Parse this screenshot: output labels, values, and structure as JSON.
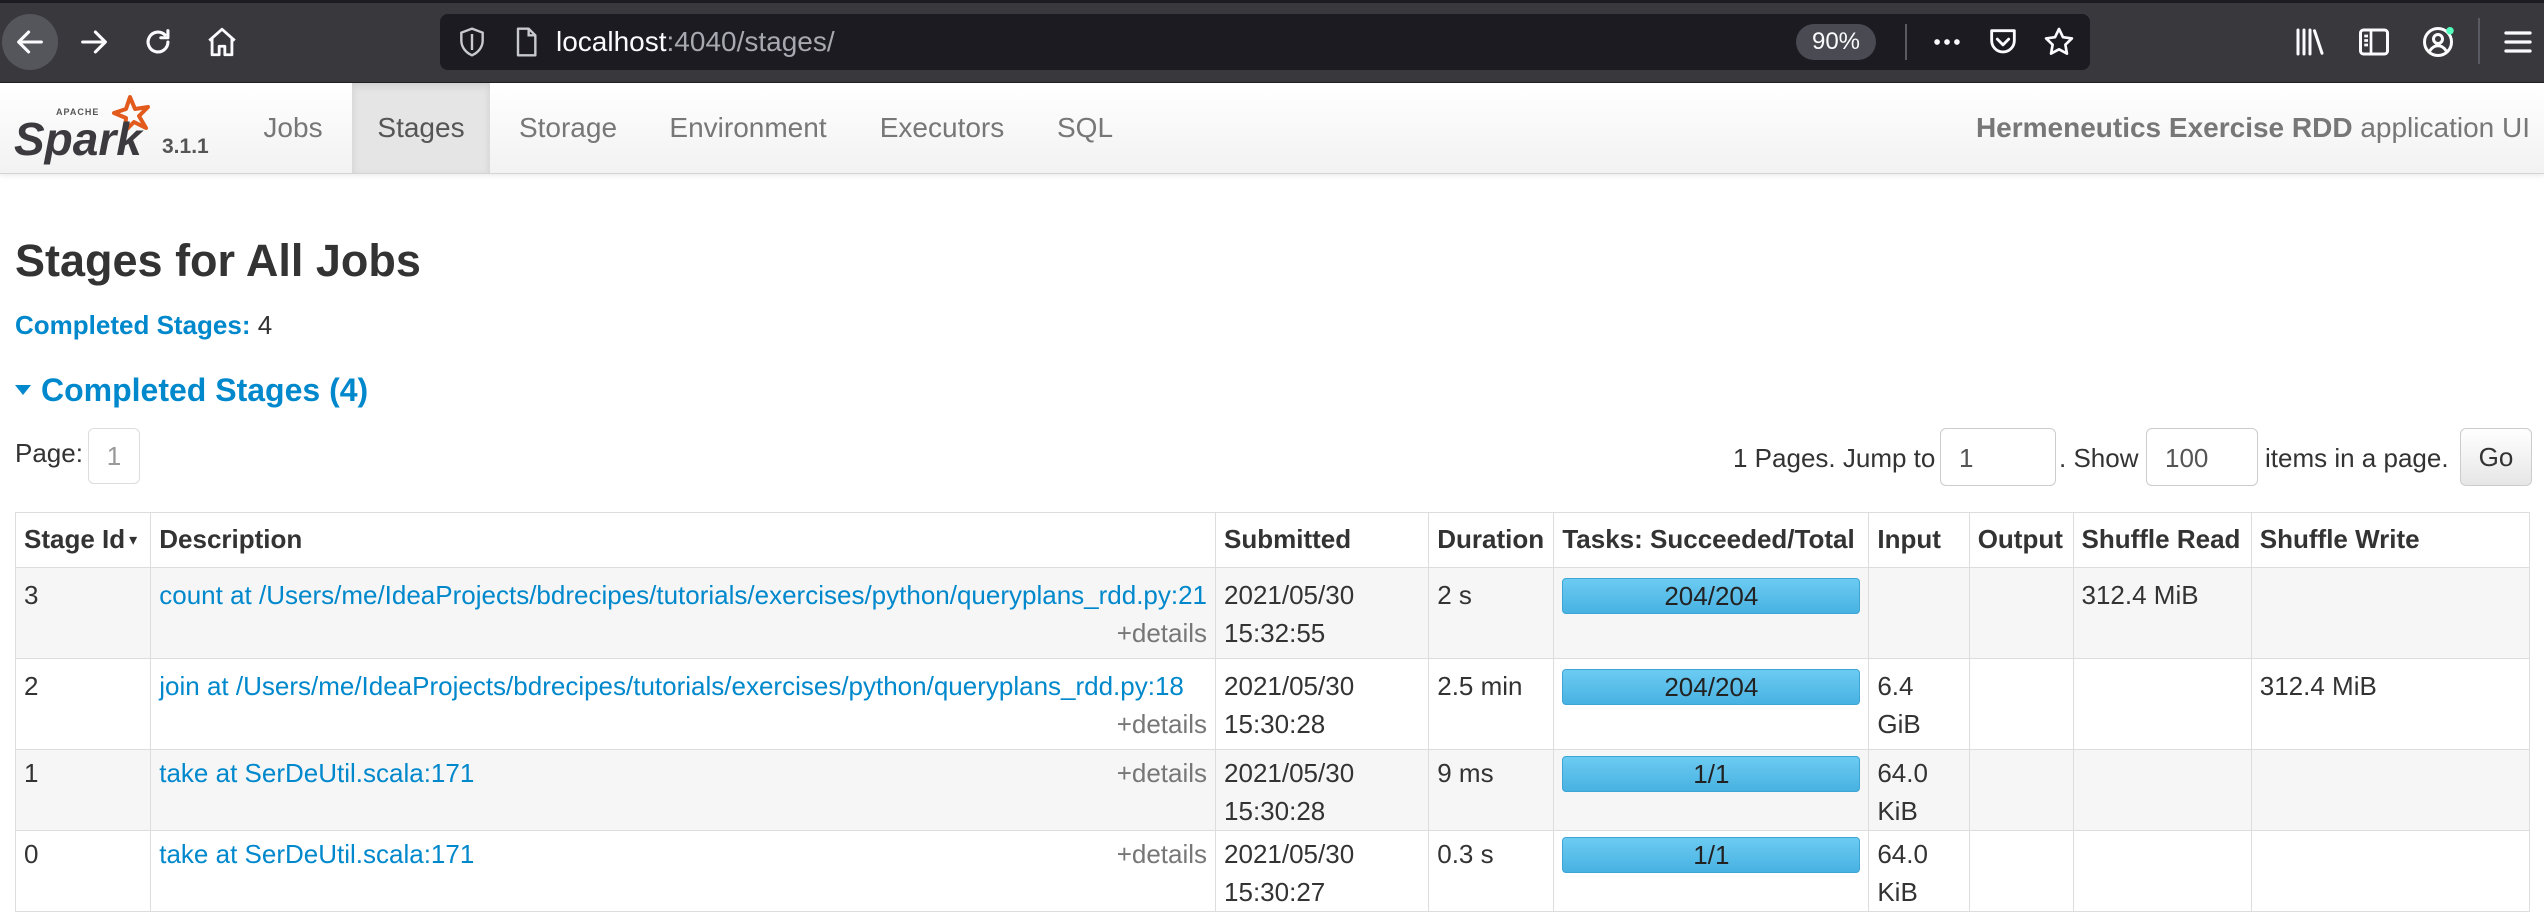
{
  "browser": {
    "url_host": "localhost",
    "url_path": ":4040/stages/",
    "zoom": "90%"
  },
  "navbar": {
    "version": "3.1.1",
    "tabs": [
      {
        "label": "Jobs"
      },
      {
        "label": "Stages"
      },
      {
        "label": "Storage"
      },
      {
        "label": "Environment"
      },
      {
        "label": "Executors"
      },
      {
        "label": "SQL"
      }
    ],
    "app_name": "Hermeneutics Exercise RDD",
    "app_suffix": "application UI"
  },
  "page": {
    "title": "Stages for All Jobs",
    "summary_label": "Completed Stages:",
    "summary_count": "4",
    "section_title": "Completed Stages (4)"
  },
  "pager": {
    "page_label": "Page:",
    "page_value": "1",
    "pages_text": "1 Pages. Jump to",
    "jump_value": "1",
    "show_text": ". Show",
    "show_value": "100",
    "items_text": "items in a page.",
    "go_label": "Go"
  },
  "table": {
    "headers": [
      "Stage Id",
      "Description",
      "Submitted",
      "Duration",
      "Tasks: Succeeded/Total",
      "Input",
      "Output",
      "Shuffle Read",
      "Shuffle Write"
    ],
    "sort_indicator": "▾",
    "details_label": "+details",
    "rows": [
      {
        "id": "3",
        "description": "count at /Users/me/IdeaProjects/bdrecipes/tutorials/exercises/python/queryplans_rdd.py:21",
        "submitted": "2021/05/30 15:32:55",
        "duration": "2 s",
        "tasks": "204/204",
        "input": "",
        "output": "",
        "shuffle_read": "312.4 MiB",
        "shuffle_write": ""
      },
      {
        "id": "2",
        "description": "join at /Users/me/IdeaProjects/bdrecipes/tutorials/exercises/python/queryplans_rdd.py:18",
        "submitted": "2021/05/30 15:30:28",
        "duration": "2.5 min",
        "tasks": "204/204",
        "input": "6.4 GiB",
        "output": "",
        "shuffle_read": "",
        "shuffle_write": "312.4 MiB"
      },
      {
        "id": "1",
        "description": "take at SerDeUtil.scala:171",
        "submitted": "2021/05/30 15:30:28",
        "duration": "9 ms",
        "tasks": "1/1",
        "input": "64.0 KiB",
        "output": "",
        "shuffle_read": "",
        "shuffle_write": ""
      },
      {
        "id": "0",
        "description": "take at SerDeUtil.scala:171",
        "submitted": "2021/05/30 15:30:27",
        "duration": "0.3 s",
        "tasks": "1/1",
        "input": "64.0 KiB",
        "output": "",
        "shuffle_read": "",
        "shuffle_write": ""
      }
    ]
  }
}
